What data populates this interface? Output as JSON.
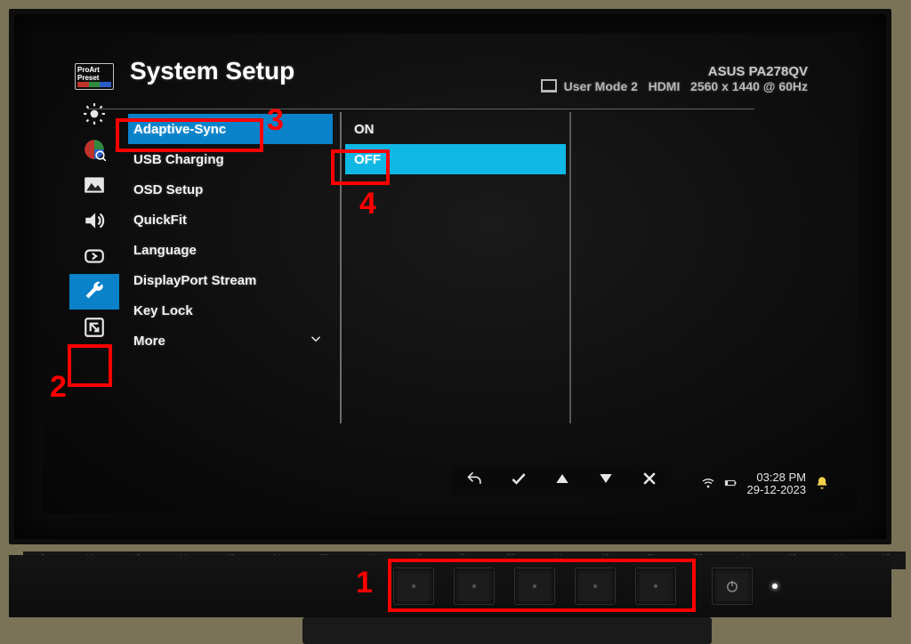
{
  "header": {
    "title": "System Setup",
    "model": "ASUS PA278QV",
    "mode": "User Mode 2",
    "input": "HDMI",
    "resolution": "2560 x 1440 @ 60Hz"
  },
  "proart_label1": "ProArt",
  "proart_label2": "Preset",
  "sidebar_icons": [
    "proart-preset",
    "brightness",
    "color-pie",
    "image",
    "sound",
    "input-source",
    "system-setup",
    "shortcut"
  ],
  "sidebar_selected_index": 6,
  "menu": {
    "items": [
      "Adaptive-Sync",
      "USB Charging",
      "OSD Setup",
      "QuickFit",
      "Language",
      "DisplayPort Stream",
      "Key Lock",
      "More"
    ],
    "selected_index": 0
  },
  "options": {
    "values": [
      "ON",
      "OFF"
    ],
    "selected_index": 1
  },
  "tray": {
    "time": "03:28 PM",
    "date": "29-12-2023"
  },
  "annotations": {
    "l1": "1",
    "l2": "2",
    "l3": "3",
    "l4": "4"
  },
  "ruler": [
    "5",
    "10",
    "15",
    "20",
    "25",
    "30",
    "35",
    "40",
    "45",
    "50",
    "55",
    "60",
    "65",
    "70",
    "75",
    "80",
    "85",
    "90",
    "95"
  ]
}
